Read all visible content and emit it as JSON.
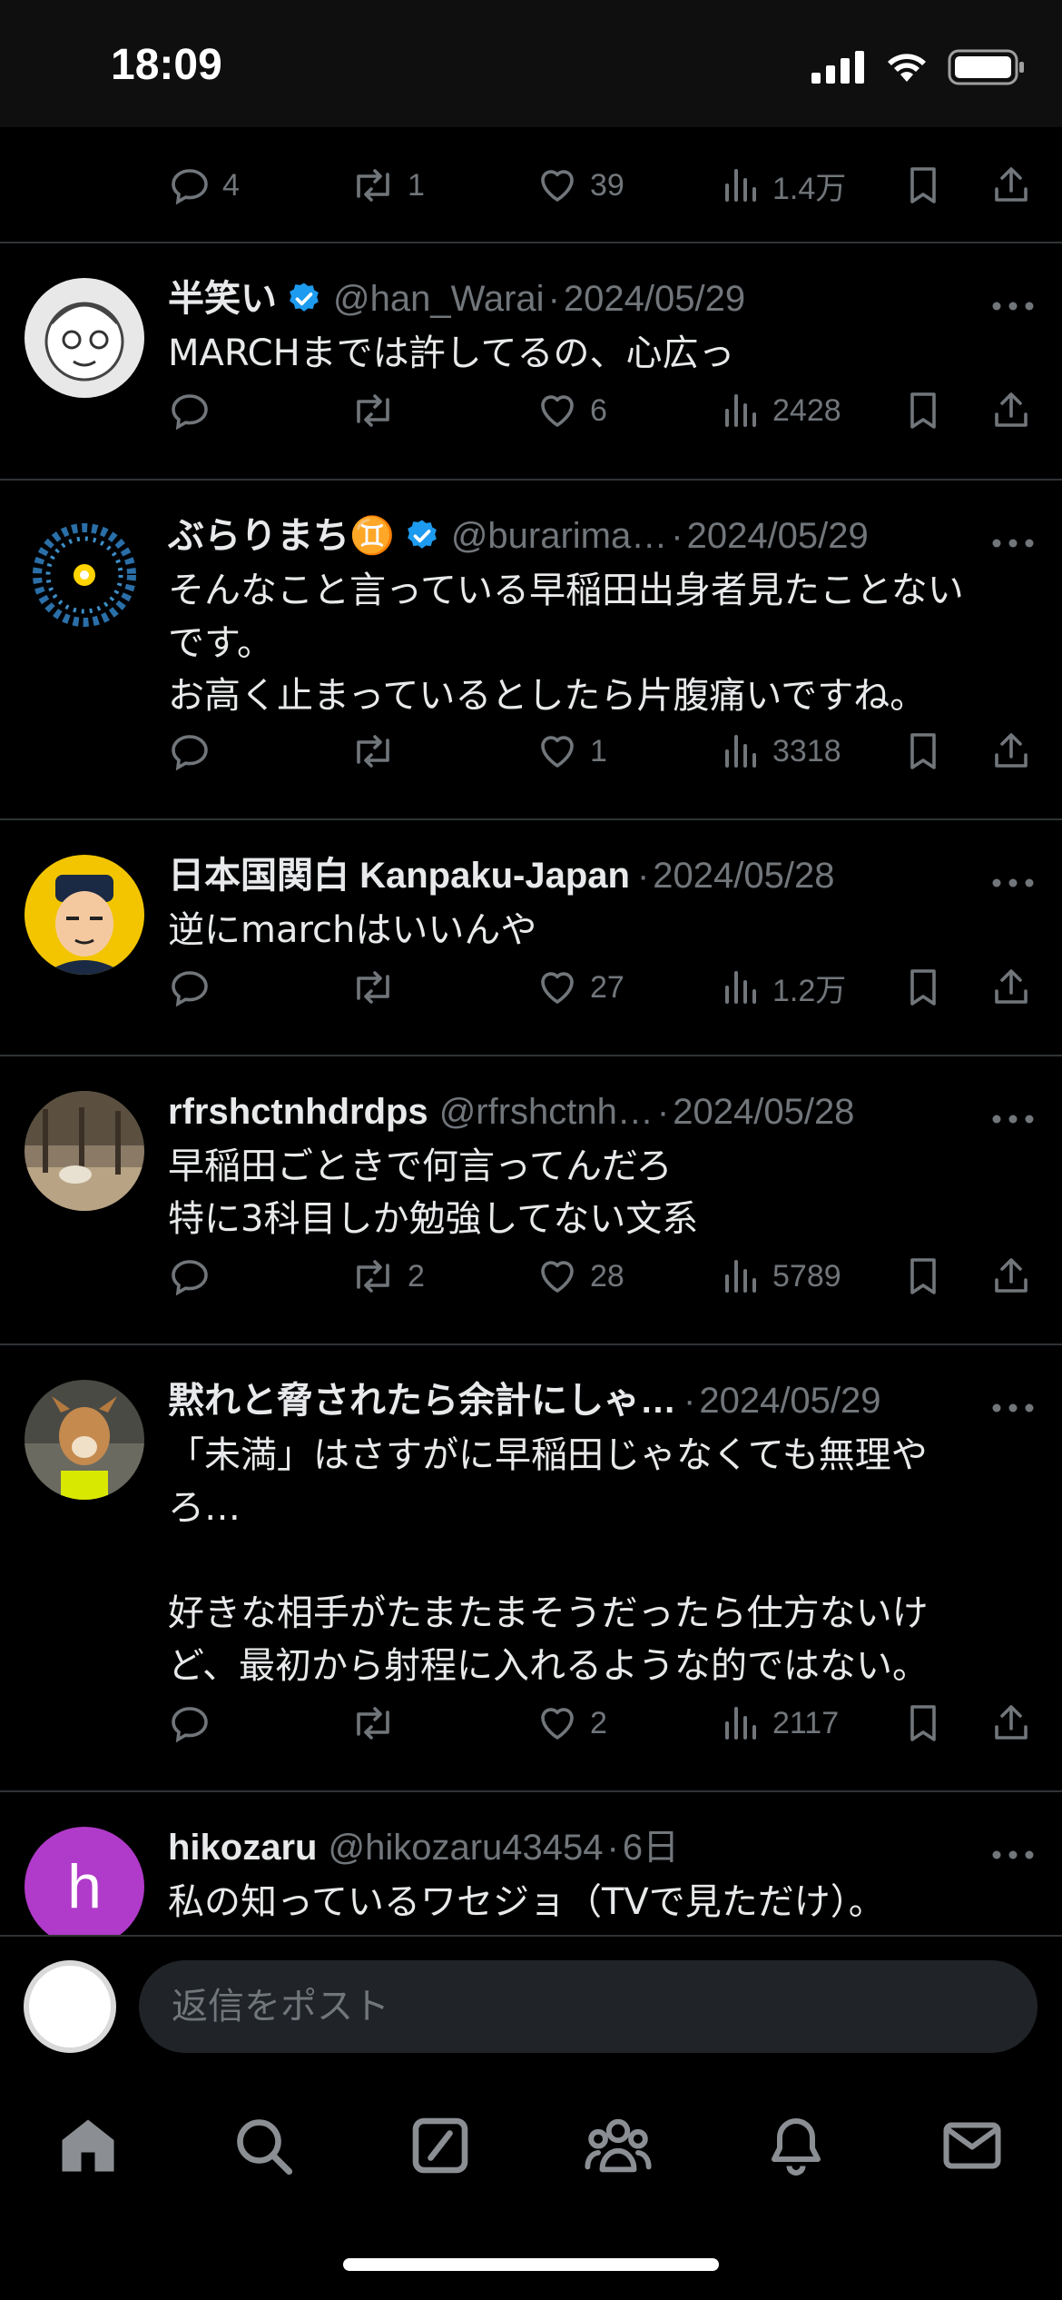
{
  "status_bar": {
    "time": "18:09"
  },
  "first_post_actions": {
    "replies": "4",
    "reposts": "1",
    "likes": "39",
    "views": "1.4万"
  },
  "posts": [
    {
      "name": "半笑い",
      "verified": true,
      "handle": "@han_Warai",
      "date": "2024/05/29",
      "text": "MARCHまでは許してるの、心広っ",
      "replies": "",
      "reposts": "",
      "likes": "6",
      "views": "2428"
    },
    {
      "name": "ぶらりまち♊",
      "verified": true,
      "handle": "@burarima…",
      "date": "2024/05/29",
      "text": "そんなこと言っている早稲田出身者見たことない\nです。\nお高く止まっているとしたら片腹痛いですね。",
      "replies": "",
      "reposts": "",
      "likes": "1",
      "views": "3318"
    },
    {
      "name": "日本国関白 Kanpaku-Japan",
      "verified": false,
      "handle": "",
      "date": "2024/05/28",
      "text": "逆にmarchはいいんや",
      "replies": "",
      "reposts": "",
      "likes": "27",
      "views": "1.2万"
    },
    {
      "name": "rfrshctnhdrdps",
      "verified": false,
      "handle": "@rfrshctnh…",
      "date": "2024/05/28",
      "text": "早稲田ごときで何言ってんだろ\n特に3科目しか勉強してない文系",
      "replies": "",
      "reposts": "2",
      "likes": "28",
      "views": "5789"
    },
    {
      "name": "黙れと脅されたら余計にしゃ…",
      "verified": false,
      "handle": "",
      "date": "2024/05/29",
      "text": "「未満」はさすがに早稲田じゃなくても無理や\nろ…\n\n好きな相手がたまたまそうだったら仕方ないけ\nど、最初から射程に入れるような的ではない。",
      "replies": "",
      "reposts": "",
      "likes": "2",
      "views": "2117"
    },
    {
      "name": "hikozaru",
      "verified": false,
      "handle": "@hikozaru43454",
      "date": "6日",
      "text": "私の知っているワセジョ（TVで見ただけ）。",
      "avatar_letter": "h"
    }
  ],
  "composer": {
    "placeholder": "返信をポスト"
  },
  "nav": [
    "home-icon",
    "search-icon",
    "grok-icon",
    "communities-icon",
    "notifications-icon",
    "messages-icon"
  ],
  "colors": {
    "background": "#000000",
    "text": "#e7e9ea",
    "muted": "#71767b",
    "verified": "#1d9bf0",
    "divider": "#2f3336"
  }
}
